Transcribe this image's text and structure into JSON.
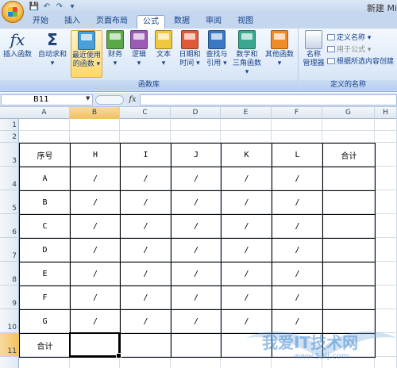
{
  "title": "新建 Mi",
  "quick_access": {
    "save": "💾",
    "undo": "↶",
    "redo": "↷",
    "customize": "▾"
  },
  "tabs": [
    "开始",
    "插入",
    "页面布局",
    "公式",
    "数据",
    "审阅",
    "视图"
  ],
  "active_tab": "公式",
  "ribbon": {
    "function_library": {
      "label": "函数库",
      "insert_function": "插入函数",
      "autosum": [
        "自动求和",
        "▾"
      ],
      "recent": [
        "最近使用",
        "的函数 ▾"
      ],
      "financial": [
        "财务",
        "▾"
      ],
      "logical": [
        "逻辑",
        "▾"
      ],
      "text": [
        "文本",
        "▾"
      ],
      "datetime": [
        "日期和",
        "时间 ▾"
      ],
      "lookup": [
        "查找与",
        "引用 ▾"
      ],
      "math": [
        "数学和",
        "三角函数 ▾"
      ],
      "more": [
        "其他函数",
        "▾"
      ]
    },
    "defined_names": {
      "label": "定义的名称",
      "name_manager": [
        "名称",
        "管理器"
      ],
      "define_name": "定义名称 ▾",
      "use_in_formula": "用于公式 ▾",
      "create_from_selection": "根据所选内容创建"
    }
  },
  "formula_bar": {
    "name_box": "B11",
    "fx": "fx",
    "formula": ""
  },
  "columns": [
    "A",
    "B",
    "C",
    "D",
    "E",
    "F",
    "G",
    "H"
  ],
  "selected_column": "B",
  "rows": [
    "1",
    "2",
    "3",
    "4",
    "5",
    "6",
    "7",
    "8",
    "9",
    "10",
    "11"
  ],
  "selected_row": "11",
  "table": {
    "header": [
      "序号",
      "H",
      "I",
      "J",
      "K",
      "L",
      "合计"
    ],
    "body": [
      [
        "A",
        "/",
        "/",
        "/",
        "/",
        "/",
        ""
      ],
      [
        "B",
        "/",
        "/",
        "/",
        "/",
        "/",
        ""
      ],
      [
        "C",
        "/",
        "/",
        "/",
        "/",
        "/",
        ""
      ],
      [
        "D",
        "/",
        "/",
        "/",
        "/",
        "/",
        ""
      ],
      [
        "E",
        "/",
        "/",
        "/",
        "/",
        "/",
        ""
      ],
      [
        "F",
        "/",
        "/",
        "/",
        "/",
        "/",
        ""
      ],
      [
        "G",
        "/",
        "/",
        "/",
        "/",
        "/",
        ""
      ],
      [
        "合计",
        "",
        "",
        "",
        "",
        "",
        ""
      ]
    ]
  },
  "watermark": {
    "title": "我爱IT技术网",
    "url": "www.52ij.com"
  },
  "colors": {
    "ribbon_bg": "#dbe8f7",
    "tab_bg": "#c5d7ee",
    "selected_header": "#f1c15f",
    "label_blue": "#15428b"
  }
}
